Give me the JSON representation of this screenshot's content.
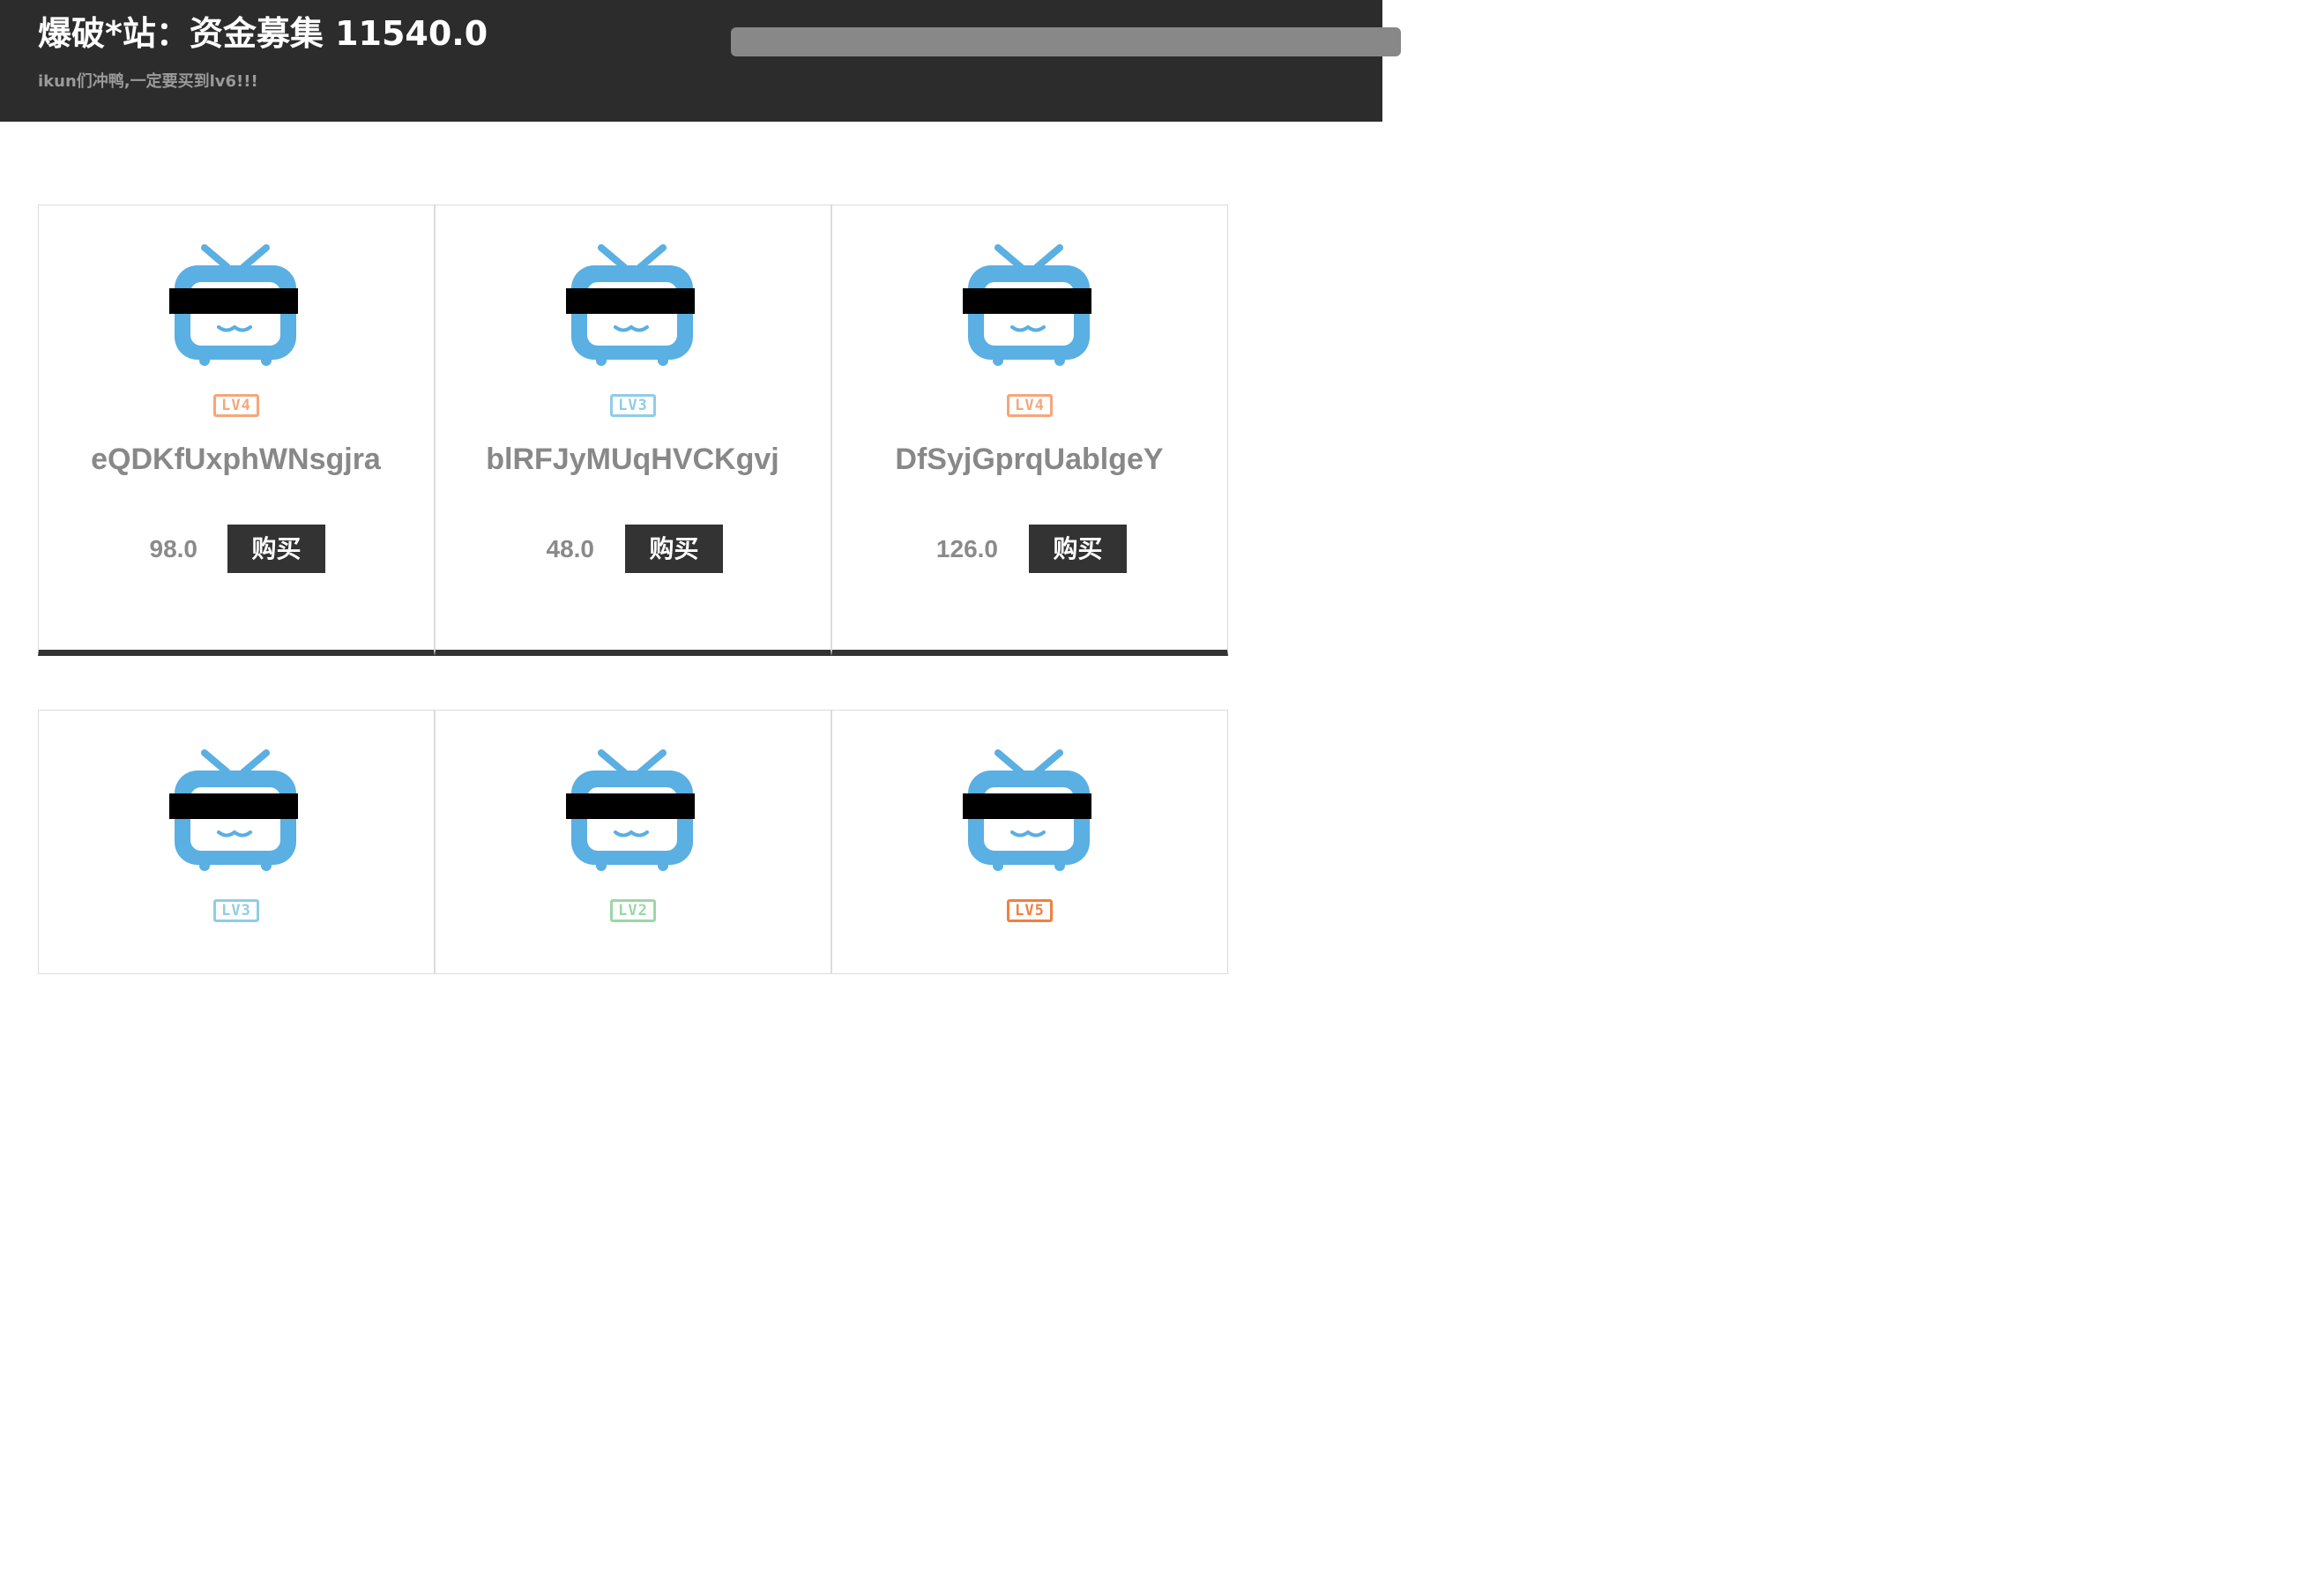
{
  "header": {
    "title": "爆破*站：资金募集 11540.0",
    "subtitle": "ikun们冲鸭,一定要买到lv6!!!"
  },
  "colors": {
    "header_bg": "#2c2c2c",
    "tv_blue": "#5aafe3",
    "button_bg": "#333333",
    "lv4": "#f5a67a",
    "lv3": "#8fcde6",
    "lv2": "#9bd7a6",
    "lv5": "#f08040"
  },
  "products": [
    {
      "level": "LV4",
      "level_color": "#f5a67a",
      "name": "eQDKfUxphWNsgjra",
      "price": "98.0",
      "buy_label": "购买"
    },
    {
      "level": "LV3",
      "level_color": "#8fcde6",
      "name": "blRFJyMUqHVCKgvj",
      "price": "48.0",
      "buy_label": "购买"
    },
    {
      "level": "LV4",
      "level_color": "#f5a67a",
      "name": "DfSyjGprqUablgeY",
      "price": "126.0",
      "buy_label": "购买"
    },
    {
      "level": "LV3",
      "level_color": "#8fcde6"
    },
    {
      "level": "LV2",
      "level_color": "#9bd7a6"
    },
    {
      "level": "LV5",
      "level_color": "#f08040"
    }
  ]
}
